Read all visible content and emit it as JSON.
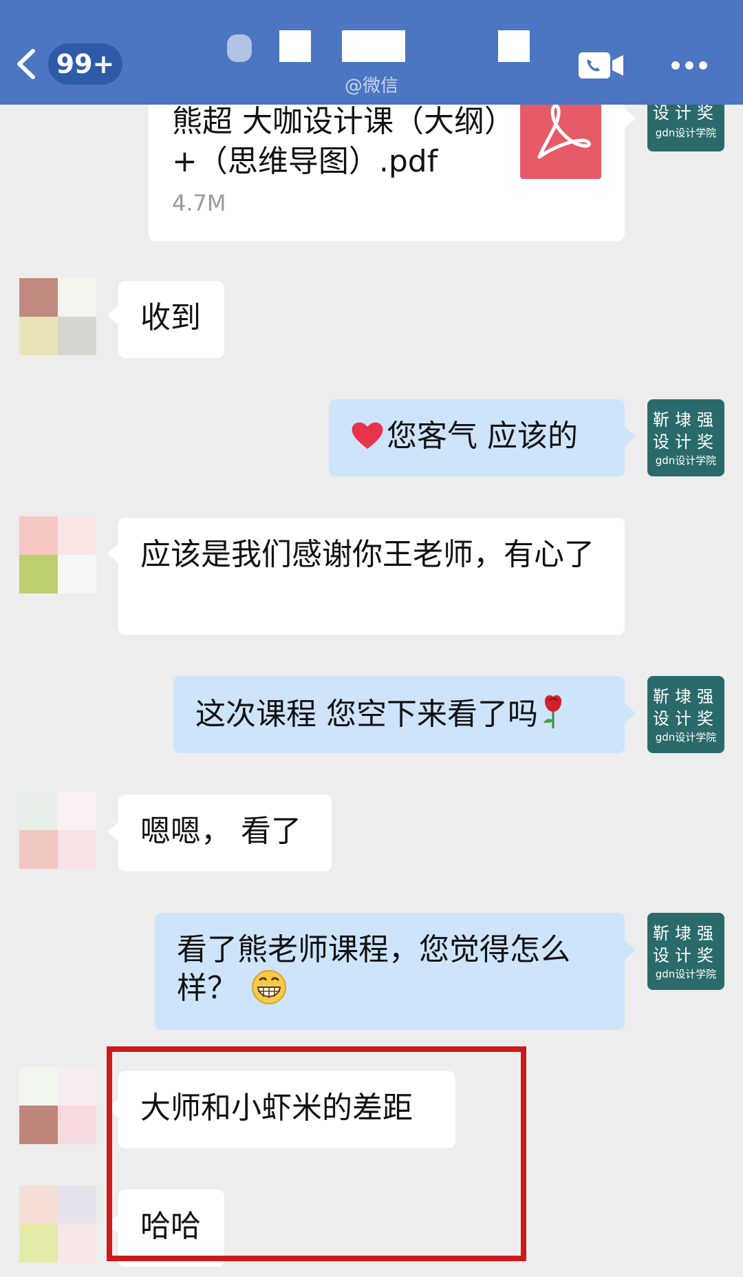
{
  "header": {
    "unread_count": "99+",
    "subtitle": "@微信"
  },
  "file": {
    "name": "熊超 大咖设计课（大纲）+（思维导图）.pdf",
    "size": "4.7M"
  },
  "sent_avatar": {
    "line1": "靳埭强",
    "line2": "设计奖",
    "line3": "gdn设计学院"
  },
  "messages": [
    {
      "from": "them",
      "text": "收到"
    },
    {
      "from": "me",
      "text": "您客气  应该的"
    },
    {
      "from": "them",
      "text": "应该是我们感谢你王老师，有心了"
    },
    {
      "from": "me",
      "text": "这次课程 您空下来看了吗"
    },
    {
      "from": "them",
      "text": "嗯嗯， 看了"
    },
    {
      "from": "me",
      "text": "看了熊老师课程，您觉得怎么样？"
    },
    {
      "from": "them",
      "text": "大师和小虾米的差距"
    },
    {
      "from": "them",
      "text": "哈哈"
    }
  ],
  "colors": {
    "header_bg": "#4c75c2",
    "sent_bubble": "#cde4fb",
    "received_bubble": "#ffffff",
    "chat_bg": "#ededed",
    "highlight_border": "#cc1a1a",
    "pdf_icon": "#e65a67"
  },
  "icons": [
    "back-icon",
    "video-call-icon",
    "more-icon",
    "pdf-icon",
    "heart-emoji",
    "rose-emoji",
    "grin-emoji"
  ]
}
